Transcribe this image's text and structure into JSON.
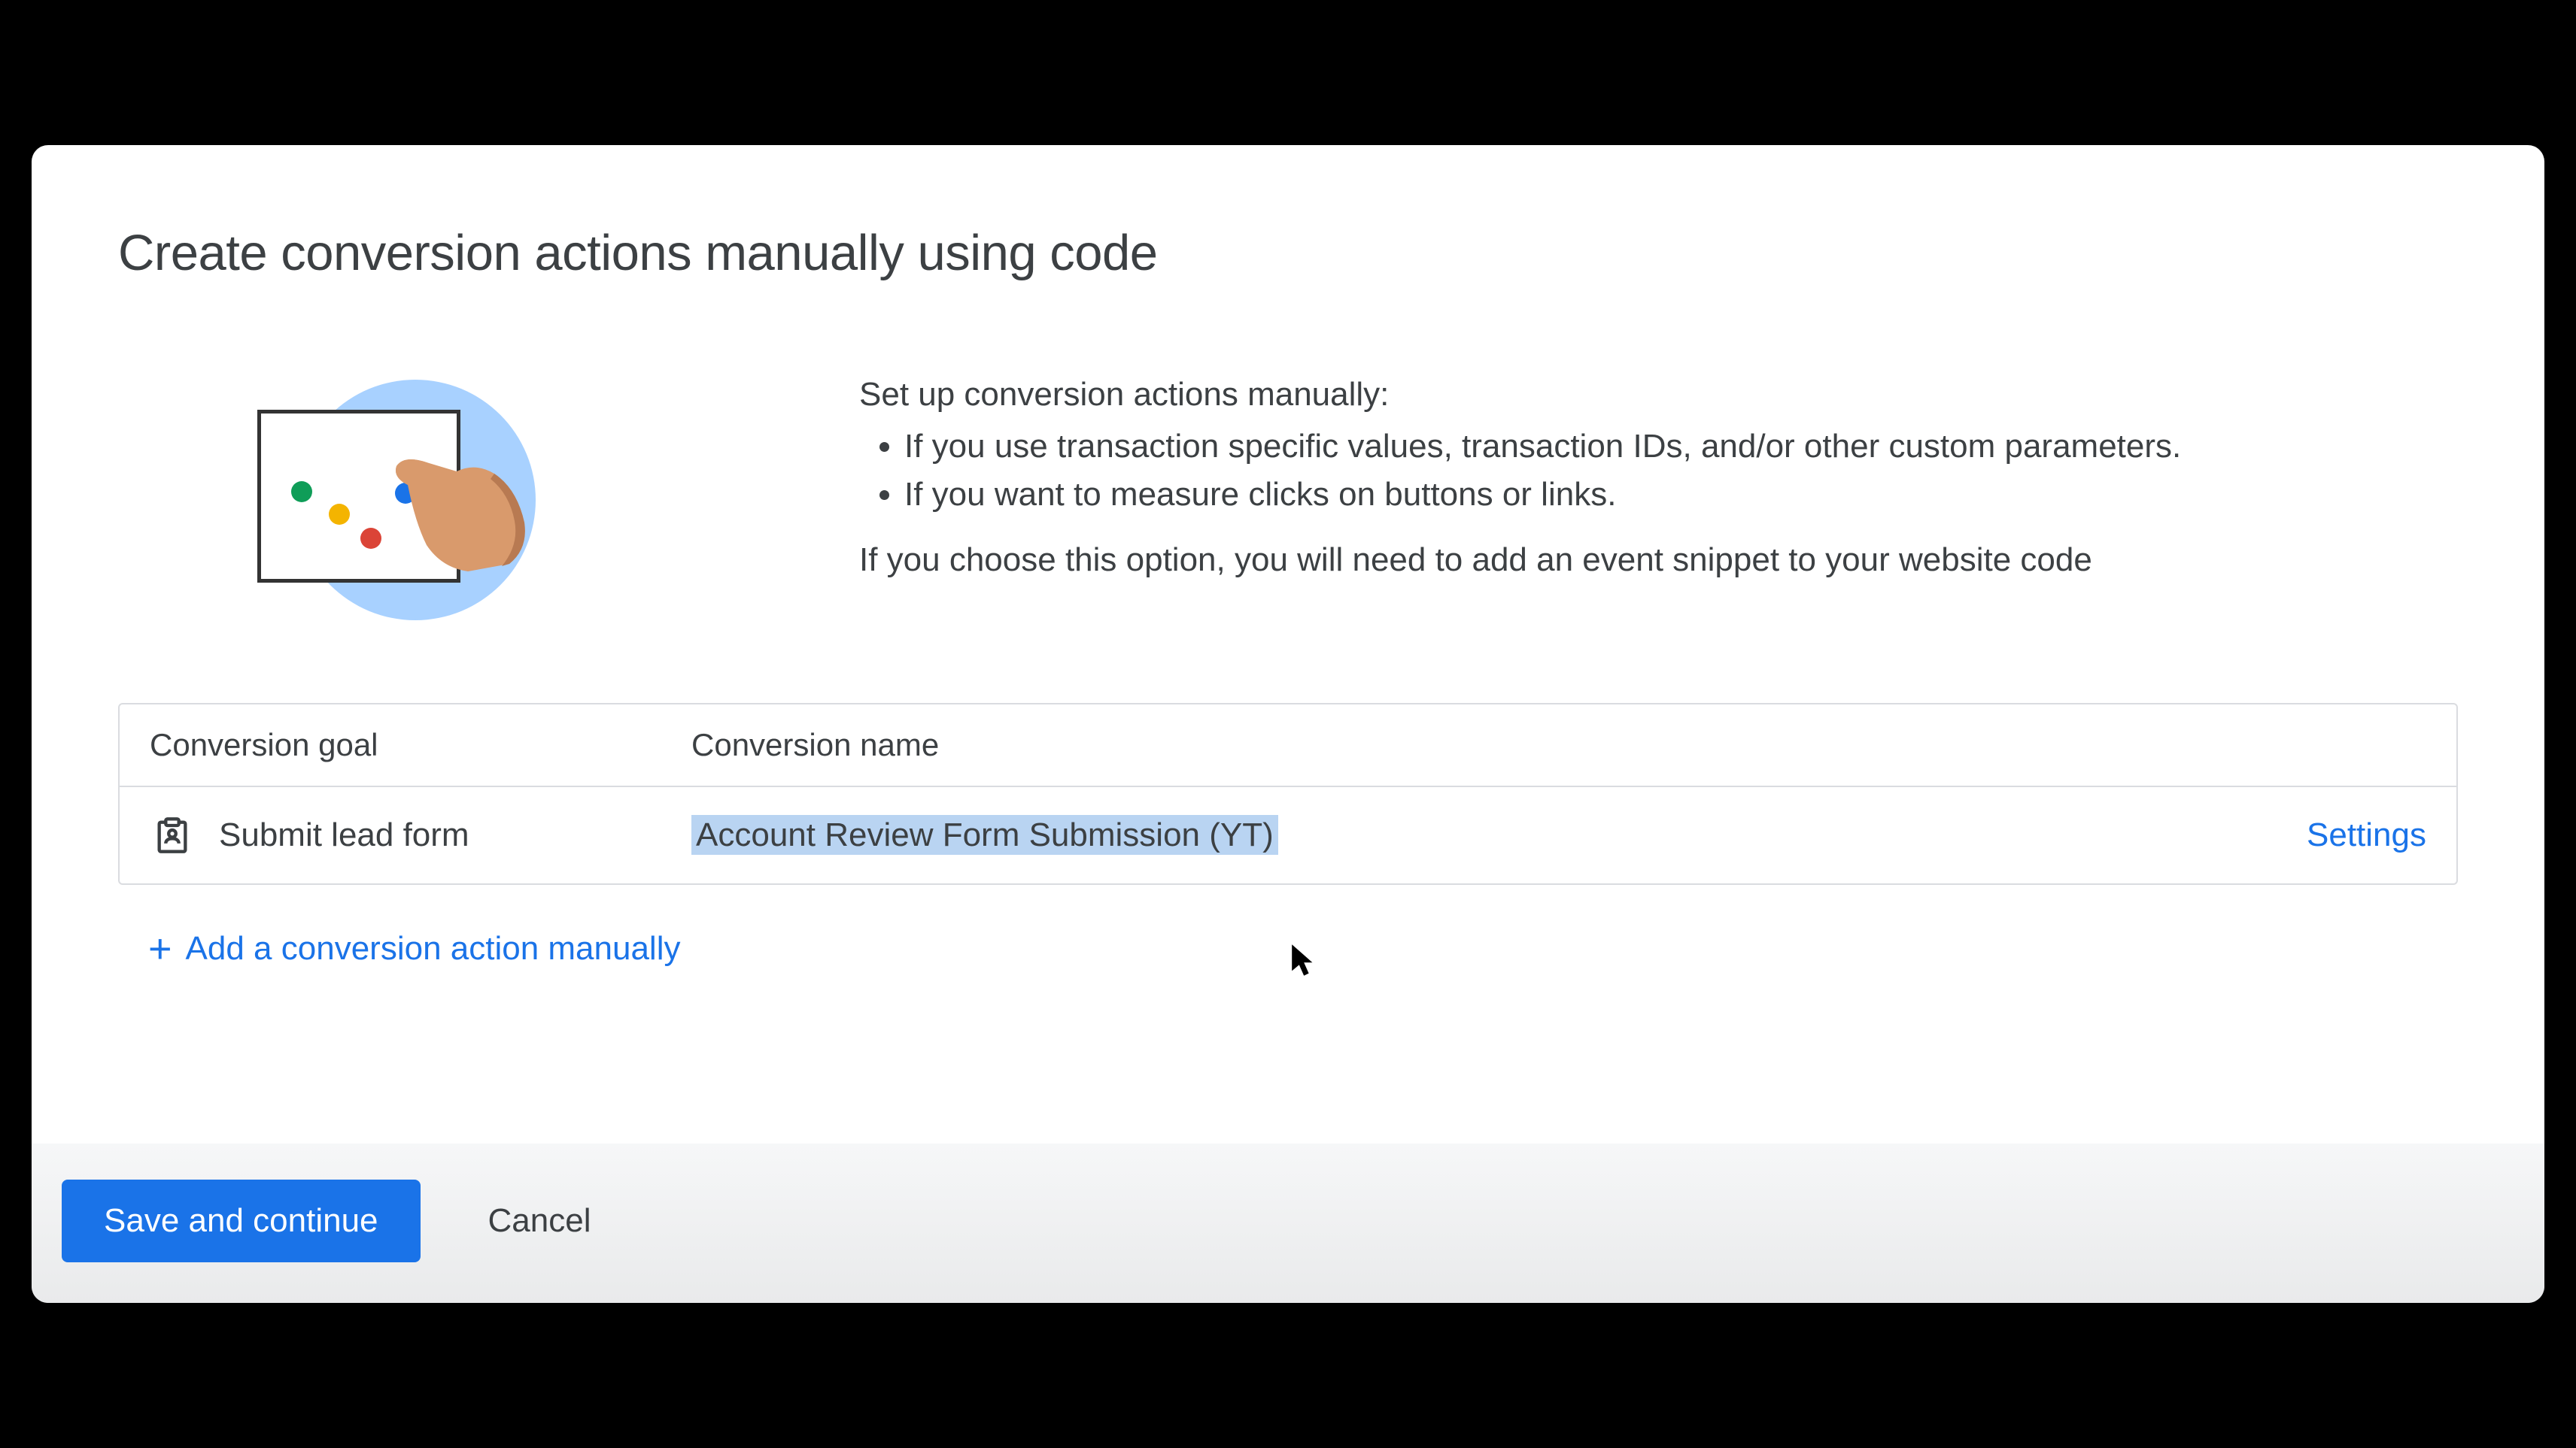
{
  "title": "Create conversion actions manually using code",
  "intro": {
    "lead": "Set up conversion actions manually:",
    "bullets": [
      "If you use transaction specific values, transaction IDs, and/or other custom parameters.",
      "If you want to measure clicks on buttons or links."
    ],
    "note": "If you choose this option, you will need to add an event snippet to your website code"
  },
  "table": {
    "headers": {
      "goal": "Conversion goal",
      "name": "Conversion name"
    },
    "row": {
      "goal": "Submit lead form",
      "name": "Account Review Form Submission (YT)",
      "settings": "Settings"
    }
  },
  "add_action": "Add a conversion action manually",
  "footer": {
    "save": "Save and continue",
    "cancel": "Cancel"
  }
}
